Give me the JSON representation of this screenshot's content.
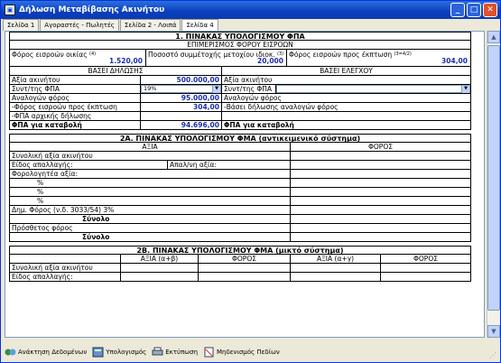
{
  "window": {
    "title": "Δήλωση Μεταβίβασης Ακινήτου"
  },
  "tabs": [
    "Σελίδα 1",
    "Αγοραστές - Πωλητές",
    "Σελίδα 2 - Λοιπά",
    "Σελίδα 4"
  ],
  "sec1": {
    "title": "1. ΠΙΝΑΚΑΣ ΥΠΟΛΟΓΙΣΜΟΥ ΦΠΑ",
    "subtitle": "ΕΠΙΜΕΡΙΣΜΟΣ ΦΟΡΟΥ ΕΙΣΡΟΩΝ",
    "c1_label": "Φόρος εισροών οικίας",
    "c1_sup": "(4)",
    "c1_value": "1.520,00",
    "c2_label": "Ποσοστό συμμέτοχής μετοχίου ιδιοκ.",
    "c2_sup": "(3)",
    "c2_value": "20,000",
    "c3_label": "Φόρος εισροών προς έκπτωση",
    "c3_sup": "(3=4/2)",
    "c3_value": "304,00",
    "left_header": "ΒΑΣΕΙ ΔΗΛΩΣΗΣ",
    "right_header": "ΒΑΣΕΙ ΕΛΕΓΧΟΥ",
    "left_rows": [
      {
        "label": "Αξία ακινήτου",
        "value": "500.000,00"
      },
      {
        "label": "Συντ/της ΦΠΑ",
        "select": "19%"
      },
      {
        "label": "Αναλογών φόρος",
        "value": "95.000,00"
      },
      {
        "label": "-Φόρος εισροών προς έκπτωση",
        "value": "304,00"
      },
      {
        "label": "-ΦΠΑ αρχικής δήλωσης",
        "value": ""
      },
      {
        "label": "ΦΠΑ για καταβολή",
        "value": "94.696,00",
        "bold": true
      }
    ],
    "right_rows": [
      {
        "label": "Αξία ακινήτου"
      },
      {
        "label": "Συντ/της ΦΠΑ",
        "select": ""
      },
      {
        "label": "Αναλογών φόρος"
      },
      {
        "label": "-Βάσει δήλωσης αναλογών φόρος"
      },
      {
        "label": ""
      },
      {
        "label": "ΦΠΑ για καταβολή",
        "bold": true
      }
    ]
  },
  "sec2a": {
    "title": "2Α. ΠΙΝΑΚΑΣ ΥΠΟΛΟΓΙΣΜΟΥ ΦΜΑ (αντικειμενικό σύστημα)",
    "col_value": "ΑΞΙΑ",
    "col_tax": "ΦΟΡΟΣ",
    "total_value": "Συνολική αξία ακινήτου",
    "exemption_type": "Είδος απαλλαγής:",
    "exempt_value": "Απαλ/νη αξία:",
    "taxable_value": "Φορολογητέα αξία:",
    "percents": [
      "%",
      "%",
      "%"
    ],
    "dhm": "Δημ. Φόρος (ν.δ. 3033/54) 3%",
    "sum1": "Σύνολο",
    "extra": "Πρόσθετος φόρος",
    "sum2": "Σύνολο"
  },
  "sec2b": {
    "title": "2Β. ΠΙΝΑΚΑΣ ΥΠΟΛΟΓΙΣΜΟΥ ΦΜΑ (μικτό σύστημα)",
    "cols": [
      "ΑΞΙΑ (α+β)",
      "ΦΟΡΟΣ",
      "ΑΞΙΑ (α+γ)",
      "ΦΟΡΟΣ"
    ],
    "rows": [
      "Συνολική αξία ακινήτου",
      "Είδος απαλλαγής:"
    ]
  },
  "bottom": [
    "Ανάκτηση Δεδομένων",
    "Υπολογισμός",
    "Εκτύπωση",
    "Μηδενισμός Πεδίων"
  ]
}
